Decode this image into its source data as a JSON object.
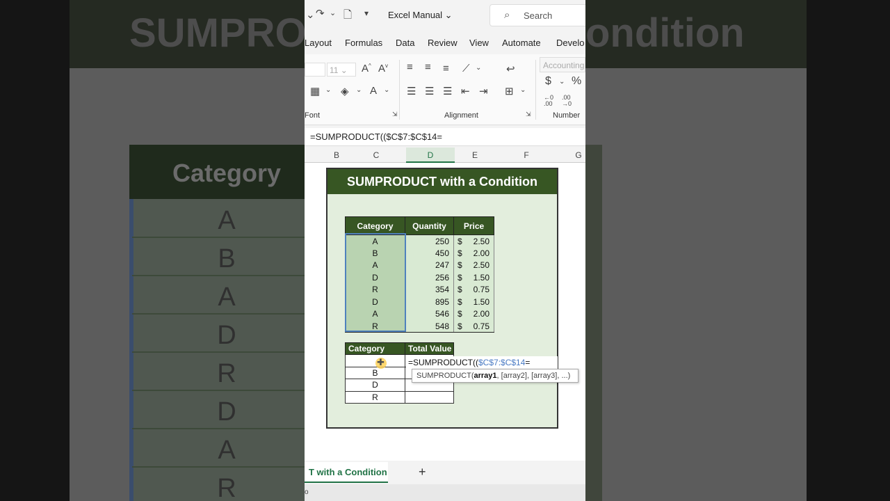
{
  "background": {
    "title_left": "SUMPROD",
    "title_right": "ondition",
    "header": "Category",
    "cells": [
      "A",
      "B",
      "A",
      "D",
      "R",
      "D",
      "A",
      "R"
    ]
  },
  "titlebar": {
    "file_name": "Excel Manual",
    "search_placeholder": "Search"
  },
  "ribbon_tabs": [
    "Layout",
    "Formulas",
    "Data",
    "Review",
    "View",
    "Automate",
    "Develo"
  ],
  "ribbon": {
    "font_size": "11",
    "number_format": "Accounting",
    "groups": {
      "font": "Font",
      "alignment": "Alignment",
      "number": "Number"
    }
  },
  "formula_bar": {
    "text": "=SUMPRODUCT(($C$7:$C$14="
  },
  "column_headers": [
    "B",
    "C",
    "D",
    "E",
    "F",
    "G"
  ],
  "sheet": {
    "title": "SUMPRODUCT with a Condition",
    "table1": {
      "headers": [
        "Category",
        "Quantity",
        "Price"
      ],
      "rows": [
        {
          "category": "A",
          "quantity": "250",
          "currency": "$",
          "price": "2.50"
        },
        {
          "category": "B",
          "quantity": "450",
          "currency": "$",
          "price": "2.00"
        },
        {
          "category": "A",
          "quantity": "247",
          "currency": "$",
          "price": "2.50"
        },
        {
          "category": "D",
          "quantity": "256",
          "currency": "$",
          "price": "1.50"
        },
        {
          "category": "R",
          "quantity": "354",
          "currency": "$",
          "price": "0.75"
        },
        {
          "category": "D",
          "quantity": "895",
          "currency": "$",
          "price": "1.50"
        },
        {
          "category": "A",
          "quantity": "546",
          "currency": "$",
          "price": "2.00"
        },
        {
          "category": "R",
          "quantity": "548",
          "currency": "$",
          "price": "0.75"
        }
      ]
    },
    "table2": {
      "headers": [
        "Category",
        "Total Value"
      ],
      "rows": [
        "",
        "B",
        "D",
        "R"
      ]
    },
    "edit_cell": {
      "prefix": "=SUMPRODUCT((",
      "ref": "$C$7:$C$14",
      "suffix": "="
    },
    "tooltip": {
      "fn": "SUMPRODUCT(",
      "arg1": "array1",
      "rest": ", [array2], [array3], ...)"
    }
  },
  "sheet_tabs": {
    "active": "T with a Condition",
    "add": "+"
  },
  "status": {
    "text": "o"
  }
}
